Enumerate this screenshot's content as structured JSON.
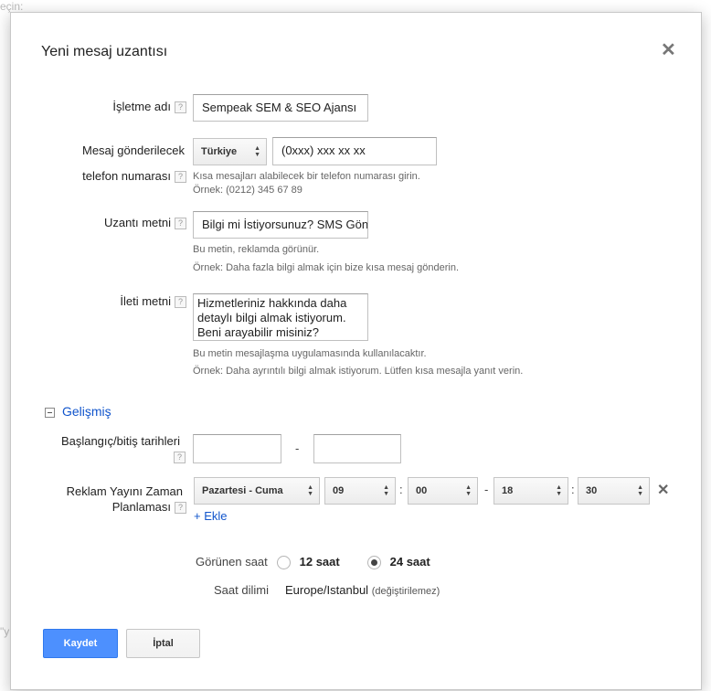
{
  "background": {
    "text_top": "eçin:",
    "text_bottom": "\"y"
  },
  "dialog": {
    "title": "Yeni mesaj uzantısı"
  },
  "business_name": {
    "label": "İşletme adı",
    "value": "Sempeak SEM & SEO Ajansı"
  },
  "phone": {
    "label_line1": "Mesaj gönderilecek",
    "label_line2": "telefon numarası",
    "country": "Türkiye",
    "value": "(0xxx) xxx xx xx",
    "hint_line1": "Kısa mesajları alabilecek bir telefon numarası girin.",
    "hint_line2": "Örnek: (0212) 345 67 89"
  },
  "extension_text": {
    "label": "Uzantı metni",
    "value": "Bilgi mi İstiyorsunuz? SMS Gönderin",
    "hint_line1": "Bu metin, reklamda görünür.",
    "hint_line2": "Örnek: Daha fazla bilgi almak için bize kısa mesaj gönderin."
  },
  "message_text": {
    "label": "İleti metni",
    "value": "Hizmetleriniz hakkında daha\ndetaylı bilgi almak istiyorum.\nBeni arayabilir misiniz?",
    "hint_line1": "Bu metin mesajlaşma uygulamasında kullanılacaktır.",
    "hint_line2": "Örnek: Daha ayrıntılı bilgi almak istiyorum. Lütfen kısa mesajla yanıt verin."
  },
  "advanced": {
    "label": "Gelişmiş"
  },
  "dates": {
    "label": "Başlangıç/bitiş tarihleri",
    "start": "",
    "end": "",
    "separator": "-"
  },
  "schedule": {
    "label_line1": "Reklam Yayını Zaman",
    "label_line2": "Planlaması",
    "day": "Pazartesi - Cuma",
    "start_hour": "09",
    "start_min": "00",
    "end_hour": "18",
    "end_min": "30",
    "colon": ":",
    "dash": "-",
    "add_label": "+ Ekle"
  },
  "time_display": {
    "label": "Görünen saat",
    "option1": "12 saat",
    "option2": "24 saat",
    "selected": "24 saat"
  },
  "timezone": {
    "label": "Saat dilimi",
    "value": "Europe/Istanbul",
    "note": "(değiştirilemez)"
  },
  "buttons": {
    "save": "Kaydet",
    "cancel": "İptal"
  },
  "colors": {
    "primary": "#4d90fe",
    "link": "#1155cc"
  }
}
